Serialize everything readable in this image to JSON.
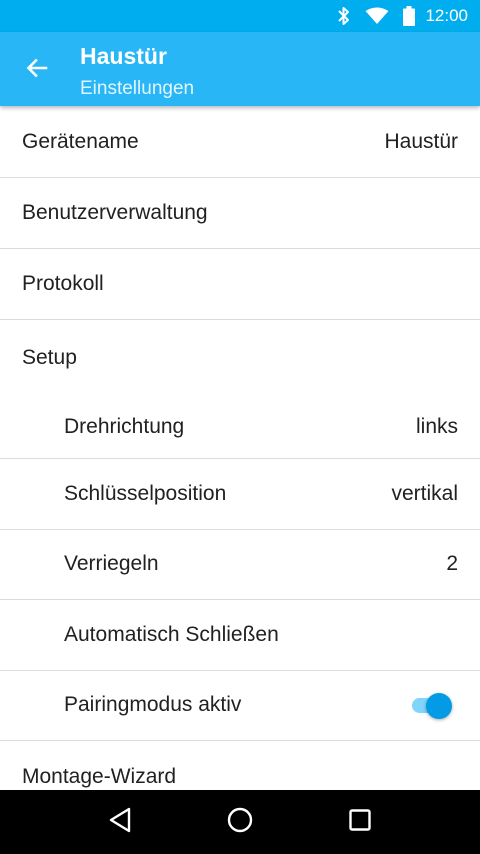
{
  "status_bar": {
    "time": "12:00",
    "icons": [
      "bluetooth-icon",
      "wifi-icon",
      "battery-icon"
    ],
    "color": "#00aeef"
  },
  "app_bar": {
    "title": "Haustür",
    "subtitle": "Einstellungen",
    "back_icon": "arrow-back-icon",
    "color": "#29b6f6"
  },
  "settings": {
    "device_name": {
      "label": "Gerätename",
      "value": "Haustür"
    },
    "user_management": {
      "label": "Benutzerverwaltung"
    },
    "log": {
      "label": "Protokoll"
    },
    "setup": {
      "label": "Setup"
    },
    "rotation": {
      "label": "Drehrichtung",
      "value": "links"
    },
    "key_position": {
      "label": "Schlüsselposition",
      "value": "vertikal"
    },
    "lock_turns": {
      "label": "Verriegeln",
      "value": "2"
    },
    "auto_close": {
      "label": "Automatisch Schließen"
    },
    "pairing_mode": {
      "label": "Pairingmodus aktiv",
      "enabled": true,
      "accent": "#039be5"
    },
    "wizard": {
      "label": "Montage-Wizard"
    }
  },
  "nav_bar": {
    "icons": [
      "back-triangle-icon",
      "home-circle-icon",
      "recents-square-icon"
    ]
  }
}
